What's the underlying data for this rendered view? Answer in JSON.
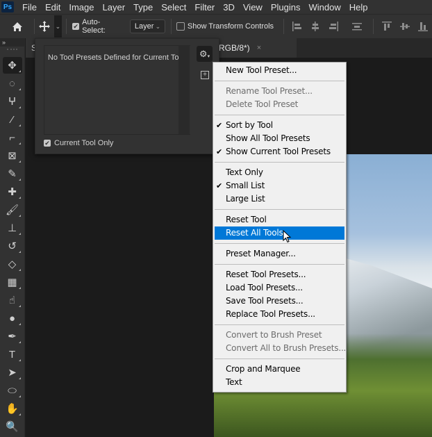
{
  "app": {
    "logo": "Ps"
  },
  "menubar": {
    "items": [
      "File",
      "Edit",
      "Image",
      "Layer",
      "Type",
      "Select",
      "Filter",
      "3D",
      "View",
      "Plugins",
      "Window",
      "Help"
    ]
  },
  "options_bar": {
    "home_icon": "home-icon",
    "move_icon": "move-icon",
    "auto_select_label": "Auto-Select:",
    "auto_select_checked": true,
    "auto_select_target": "Layer",
    "show_transform_label": "Show Transform Controls",
    "show_transform_checked": false,
    "align_icons": [
      "align-left-edges-icon",
      "align-horizontal-centers-icon",
      "align-right-edges-icon",
      "distribute-vertical-icon",
      "align-top-edges-icon",
      "align-vertical-centers-icon",
      "align-bottom-edges-icon"
    ]
  },
  "toolbar": {
    "collapse_label": "»",
    "tools": [
      {
        "name": "move-tool",
        "glyph": "✥",
        "active": true
      },
      {
        "name": "marquee-tool",
        "glyph": "◌"
      },
      {
        "name": "lasso-tool",
        "glyph": "ⵖ"
      },
      {
        "name": "magic-wand-tool",
        "glyph": "⁄"
      },
      {
        "name": "crop-tool",
        "glyph": "⌐"
      },
      {
        "name": "frame-tool",
        "glyph": "⊠"
      },
      {
        "name": "eyedropper-tool",
        "glyph": "✎"
      },
      {
        "name": "healing-brush-tool",
        "glyph": "✚"
      },
      {
        "name": "brush-tool",
        "glyph": "🖌"
      },
      {
        "name": "clone-stamp-tool",
        "glyph": "⊥"
      },
      {
        "name": "history-brush-tool",
        "glyph": "↺"
      },
      {
        "name": "eraser-tool",
        "glyph": "◇"
      },
      {
        "name": "gradient-tool",
        "glyph": "▦"
      },
      {
        "name": "smudge-tool",
        "glyph": "☝"
      },
      {
        "name": "dodge-tool",
        "glyph": "●"
      },
      {
        "name": "pen-tool",
        "glyph": "✒"
      },
      {
        "name": "type-tool",
        "glyph": "T"
      },
      {
        "name": "path-selection-tool",
        "glyph": "➤"
      },
      {
        "name": "ellipse-tool",
        "glyph": "⬭"
      },
      {
        "name": "hand-tool",
        "glyph": "✋"
      },
      {
        "name": "zoom-tool",
        "glyph": "🔍"
      }
    ]
  },
  "document_tab": {
    "title_partial": "RGB/8*)",
    "left_partial": "S",
    "close_glyph": "×"
  },
  "presets_panel": {
    "empty_message": "No Tool Presets Defined for Current Tool.",
    "current_tool_only_label": "Current Tool Only",
    "current_tool_only_checked": true,
    "gear_icon": "gear-icon",
    "new_preset_icon": "new-preset-icon"
  },
  "context_menu": {
    "highlighted": "Reset All Tools",
    "groups": [
      [
        {
          "label": "New Tool Preset..."
        }
      ],
      [
        {
          "label": "Rename Tool Preset...",
          "disabled": true
        },
        {
          "label": "Delete Tool Preset",
          "disabled": true
        }
      ],
      [
        {
          "label": "Sort by Tool",
          "checked": true
        },
        {
          "label": "Show All Tool Presets"
        },
        {
          "label": "Show Current Tool Presets",
          "checked": true
        }
      ],
      [
        {
          "label": "Text Only"
        },
        {
          "label": "Small List",
          "checked": true
        },
        {
          "label": "Large List"
        }
      ],
      [
        {
          "label": "Reset Tool"
        },
        {
          "label": "Reset All Tools",
          "highlighted": true
        }
      ],
      [
        {
          "label": "Preset Manager..."
        }
      ],
      [
        {
          "label": "Reset Tool Presets..."
        },
        {
          "label": "Load Tool Presets..."
        },
        {
          "label": "Save Tool Presets..."
        },
        {
          "label": "Replace Tool Presets..."
        }
      ],
      [
        {
          "label": "Convert to Brush Preset",
          "disabled": true
        },
        {
          "label": "Convert All to Brush Presets...",
          "disabled": true
        }
      ],
      [
        {
          "label": "Crop and Marquee"
        },
        {
          "label": "Text"
        }
      ]
    ]
  },
  "colors": {
    "highlight": "#0078d7",
    "panel_bg": "#323232",
    "menu_bg": "#f0f0f0",
    "canvas_bg": "#1b1b1b"
  }
}
